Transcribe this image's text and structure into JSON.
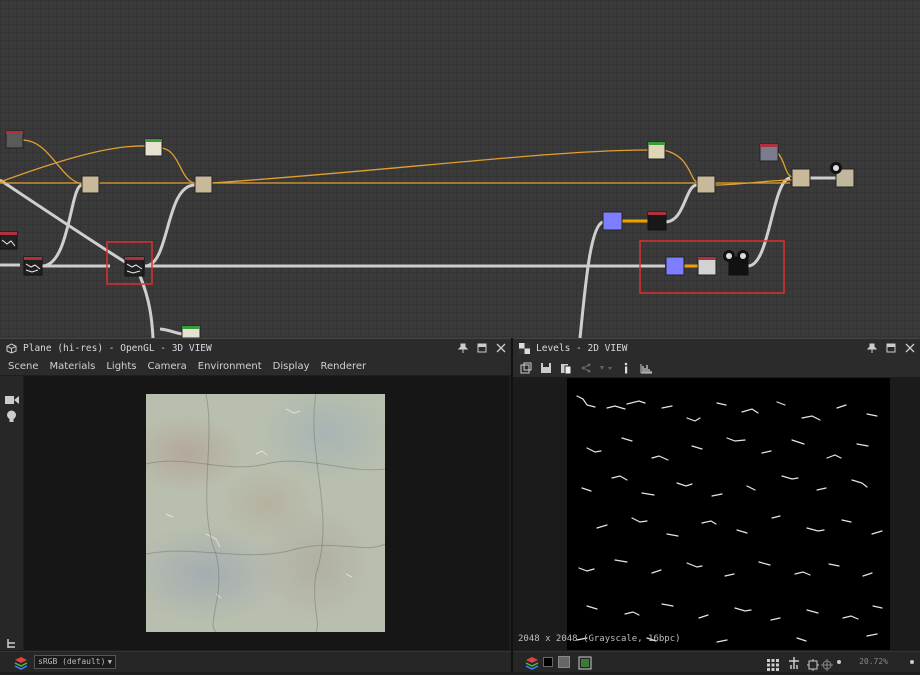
{
  "graph": {
    "highlight_color": "#e03030",
    "link_orange": "#e0a030",
    "link_gray": "#c8c8c8"
  },
  "view3d": {
    "title": "Plane (hi-res) - OpenGL - 3D VIEW",
    "menu": [
      "Scene",
      "Materials",
      "Lights",
      "Camera",
      "Environment",
      "Display",
      "Renderer"
    ],
    "color_space": "sRGB (default)"
  },
  "view2d": {
    "title": "Levels - 2D VIEW",
    "info": "2048 x 2048 (Grayscale, 16bpc)",
    "zoom": "20.72%"
  }
}
